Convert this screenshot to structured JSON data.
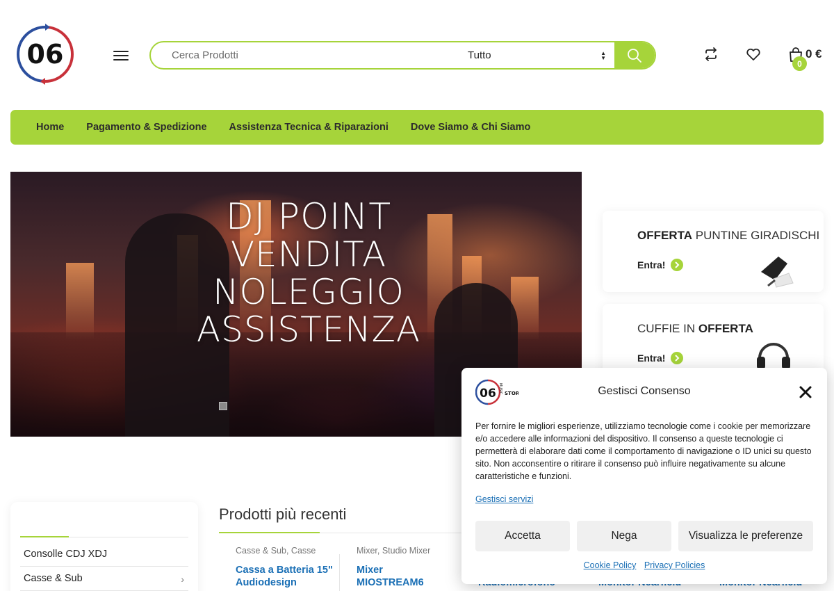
{
  "header": {
    "logo_text": "06",
    "search_placeholder": "Cerca Prodotti",
    "category_selected": "Tutto",
    "cart_count": "0",
    "cart_total": "0 €"
  },
  "nav": {
    "items": [
      "Home",
      "Pagamento & Spedizione",
      "Assistenza Tecnica & Riparazioni",
      "Dove Siamo & Chi Siamo"
    ]
  },
  "hero": {
    "line1": "DJ POINT",
    "line2": "VENDITA",
    "line3": "NOLEGGIO",
    "line4": "ASSISTENZA"
  },
  "promos": [
    {
      "bold": "OFFERTA",
      "rest": " PUNTINE GIRADISCHI",
      "cta": "Entra!"
    },
    {
      "rest": "CUFFIE IN ",
      "bold": "OFFERTA",
      "cta": "Entra!"
    }
  ],
  "sidebar": {
    "items": [
      "Consolle CDJ XDJ",
      "Casse & Sub"
    ]
  },
  "products": {
    "title": "Prodotti più recenti",
    "items": [
      {
        "cat1": "Casse & Sub",
        "cat2": "Casse",
        "name": "Cassa a Batteria 15\" Audiodesign"
      },
      {
        "cat1": "Mixer",
        "cat2": "Studio Mixer",
        "name": "Mixer MIOSTREAM6"
      }
    ],
    "partial_names": [
      "Radiomicrofono",
      "Monitor Nearfield",
      "Monitor Nearfield"
    ]
  },
  "consent": {
    "logo_text": "06",
    "logo_side": "MUSIC",
    "logo_store": "STORE",
    "title": "Gestisci Consenso",
    "body": "Per fornire le migliori esperienze, utilizziamo tecnologie come i cookie per memorizzare e/o accedere alle informazioni del dispositivo. Il consenso a queste tecnologie ci permetterà di elaborare dati come il comportamento di navigazione o ID unici su questo sito. Non acconsentire o ritirare il consenso può influire negativamente su alcune caratteristiche e funzioni.",
    "services_link": "Gestisci servizi",
    "accept": "Accetta",
    "deny": "Nega",
    "preferences": "Visualizza le preferenze",
    "cookie_policy": "Cookie Policy",
    "privacy_policy": "Privacy Policies"
  },
  "colors": {
    "accent": "#a6d43a",
    "link": "#1a6fb5"
  }
}
